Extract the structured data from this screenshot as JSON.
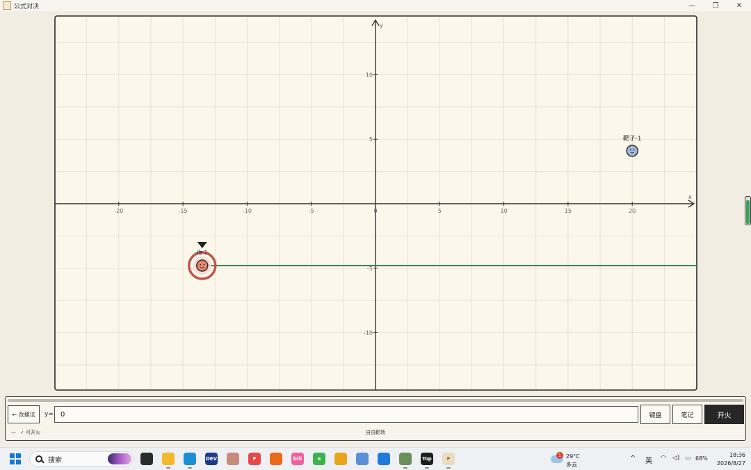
{
  "window": {
    "title": "公式对决",
    "controls": {
      "minimize": "—",
      "restore": "❐",
      "close": "✕"
    }
  },
  "plot": {
    "x_axis_label": "x",
    "y_axis_label": "y",
    "xlim": [
      -25,
      25
    ],
    "ylim": [
      -14.5,
      14.5
    ],
    "x_ticks": [
      -20,
      -15,
      -10,
      -5,
      0,
      5,
      10,
      15,
      20
    ],
    "y_ticks": [
      -10,
      -5,
      5,
      10
    ],
    "player": {
      "label": "你·1",
      "x": -13.5,
      "y": -4.8,
      "color": "#c0544a"
    },
    "target": {
      "label": "靶子·1",
      "x": 20,
      "y": 4.1,
      "color": "#9fb8d8"
    },
    "trajectory": {
      "x_start": -13.5,
      "x_end": 25,
      "y": -4.8,
      "color": "#2f8a55"
    }
  },
  "energy": {
    "level": 0.95,
    "color": "#3aa062"
  },
  "panel": {
    "switch_label": "← 改摆法",
    "eq_prefix": "y=",
    "eq_value": "0",
    "keyboard_label": "键盘",
    "notes_label": "笔记",
    "fire_label": "开火",
    "status_dash": "—",
    "status_ready": "✓ 可开火",
    "mode_label": "自由靶场"
  },
  "taskbar": {
    "search_placeholder": "搜索",
    "weather_badge": "1",
    "weather_temp": "29°C",
    "weather_cond": "多云",
    "tray_chevron": "^",
    "ime": "英",
    "battery": "68%",
    "time": "18:36",
    "date": "2026/8/27",
    "apps": [
      {
        "name": "task-view",
        "label": "",
        "color": "#2b2b2b"
      },
      {
        "name": "file-explorer",
        "label": "",
        "color": "#f2b92c"
      },
      {
        "name": "edge",
        "label": "",
        "color": "#1d8ed6"
      },
      {
        "name": "dev-home",
        "label": "DEV",
        "color": "#1f3a8a"
      },
      {
        "name": "avatar-app",
        "label": "",
        "color": "#c98b7a"
      },
      {
        "name": "feishu",
        "label": "F",
        "color": "#e54848"
      },
      {
        "name": "orange-app",
        "label": "",
        "color": "#e86b1a"
      },
      {
        "name": "bilibili",
        "label": "bili",
        "color": "#f0609a"
      },
      {
        "name": "green-app",
        "label": "e",
        "color": "#3bb34a"
      },
      {
        "name": "note-app",
        "label": "",
        "color": "#e8a51c"
      },
      {
        "name": "gear-app",
        "label": "",
        "color": "#5b8fd6"
      },
      {
        "name": "vscode",
        "label": "",
        "color": "#1f7ad9"
      },
      {
        "name": "photo-app",
        "label": "",
        "color": "#6a8f5a"
      },
      {
        "name": "top-app",
        "label": "Top",
        "color": "#1e1e1e"
      },
      {
        "name": "formula-duel-app",
        "label": "F",
        "color": "#e9dcc0"
      }
    ]
  }
}
